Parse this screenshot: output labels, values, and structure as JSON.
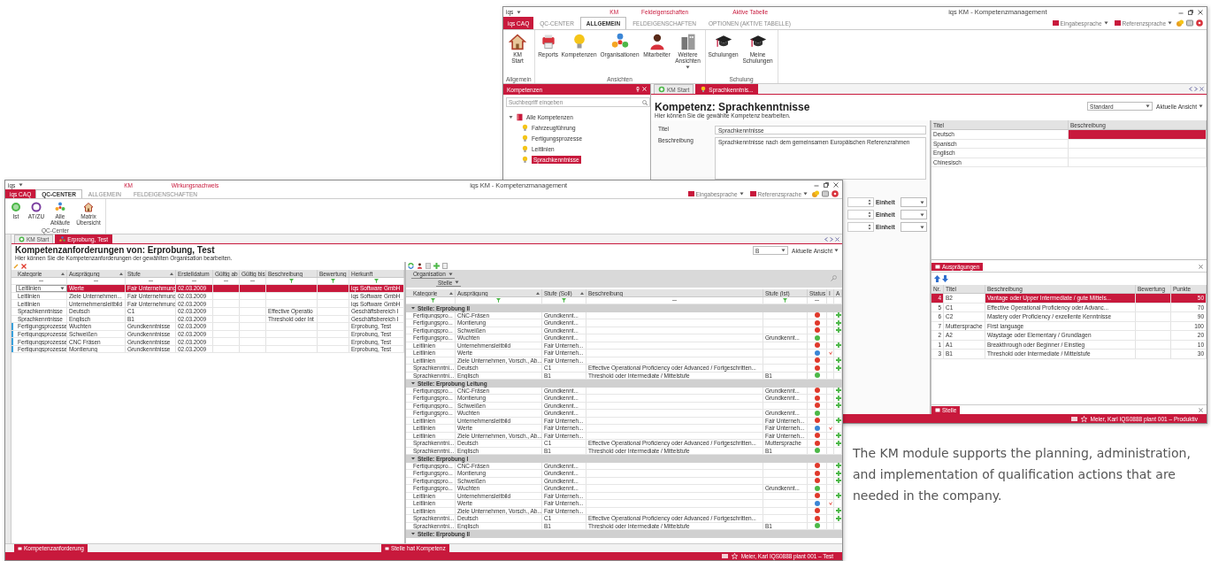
{
  "back_window": {
    "quick_access": "iqs",
    "context_labels": [
      "KM",
      "Feldeigenschaften",
      "Aktive Tabelle"
    ],
    "title": "iqs KM - Kompetenzmanagement",
    "app_menu": "iqs CAQ",
    "ribbon_tabs": [
      {
        "label": "QC-CENTER",
        "selected": false
      },
      {
        "label": "ALLGEMEIN",
        "selected": true
      },
      {
        "label": "FELDEIGENSCHAFTEN",
        "selected": false
      },
      {
        "label": "OPTIONEN (AKTIVE TABELLE)",
        "selected": false
      }
    ],
    "language_menus": [
      "Eingabesprache",
      "Referenzsprache"
    ],
    "ribbon_groups": [
      {
        "label": "Allgemein",
        "buttons": [
          {
            "label": "KM Start",
            "kind": "house"
          }
        ]
      },
      {
        "label": "Ansichten",
        "buttons": [
          {
            "label": "Reports",
            "kind": "report"
          },
          {
            "label": "Kompetenzen",
            "kind": "bulb"
          },
          {
            "label": "Organisationen",
            "kind": "org"
          },
          {
            "label": "Mitarbeiter",
            "kind": "person"
          },
          {
            "label": "Weitere Ansichten",
            "kind": "building",
            "dropdown": true
          }
        ]
      },
      {
        "label": "Schulung",
        "buttons": [
          {
            "label": "Schulungen",
            "kind": "cap"
          },
          {
            "label": "Meine Schulungen",
            "kind": "cap"
          }
        ]
      }
    ],
    "side_panel": {
      "title": "Kompetenzen",
      "search_placeholder": "Suchbegriff eingeben",
      "tree": [
        {
          "label": "Alle Kompetenzen",
          "kind": "book",
          "expanded": true,
          "selected": false,
          "children": [
            {
              "label": "Fahrzeugführung",
              "kind": "bulb",
              "selected": false
            },
            {
              "label": "Fertigungsprozesse",
              "kind": "bulb",
              "selected": false
            },
            {
              "label": "Leitlinien",
              "kind": "bulb",
              "selected": false
            },
            {
              "label": "Sprachkenntnisse",
              "kind": "bulb",
              "selected": true
            }
          ]
        }
      ]
    },
    "doc_tabs": [
      {
        "label": "KM Start",
        "kind": "start",
        "selected": false
      },
      {
        "label": "Sprachkenntnis...",
        "kind": "bulb",
        "selected": true
      }
    ],
    "heading": "Kompetenz: Sprachkenntnisse",
    "subheading": "Hier können Sie die gewählte Kompetenz bearbeiten.",
    "view_select": "Standard",
    "view_menu": "Aktuelle Ansicht",
    "fields": [
      {
        "label": "Titel",
        "value": "Sprachkenntnisse",
        "kind": "line"
      },
      {
        "label": "Beschreibung",
        "value": "Sprachkenntnisse nach dem gemeinsamen Europäischen Referenzrahmen",
        "kind": "area"
      }
    ],
    "unit_labels": [
      "Einheit",
      "Einheit",
      "Einheit"
    ],
    "translations": {
      "columns": [
        "Titel",
        "Beschreibung"
      ],
      "rows": [
        {
          "title": "Deutsch",
          "selected": true
        },
        {
          "title": "Spanisch",
          "selected": false
        },
        {
          "title": "Englisch",
          "selected": false
        },
        {
          "title": "Chinesisch",
          "selected": false
        }
      ]
    },
    "levels_panel": {
      "title": "Ausprägungen",
      "columns": [
        "Nr.",
        "Titel",
        "Beschreibung",
        "Bewertung",
        "Punkte"
      ],
      "rows": [
        {
          "nr": "4",
          "title": "B2",
          "description": "Vantage oder Upper Intermediate / gute Mittels...",
          "points": "50",
          "selected": true
        },
        {
          "nr": "5",
          "title": "C1",
          "description": "Effective Operational Proficiency oder Advanc...",
          "points": "70",
          "selected": false
        },
        {
          "nr": "6",
          "title": "C2",
          "description": "Mastery oder Proficiency / exzellente Kenntnisse",
          "points": "90",
          "selected": false
        },
        {
          "nr": "7",
          "title": "Muttersprache",
          "description": "First language",
          "points": "100",
          "selected": false
        },
        {
          "nr": "2",
          "title": "A2",
          "description": "Waystage oder Elementary / Grundlagen",
          "points": "20",
          "selected": false
        },
        {
          "nr": "1",
          "title": "A1",
          "description": "Breakthrough oder Beginner / Einstieg",
          "points": "10",
          "selected": false
        },
        {
          "nr": "3",
          "title": "B1",
          "description": "Threshold oder Intermediate / Mittelstufe",
          "points": "30",
          "selected": false
        }
      ]
    },
    "bottom_tab": "Stelle",
    "status": "Meier, Karl  IQS0888  plant 001  –  Produktiv"
  },
  "front_window": {
    "quick_access": "iqs",
    "context_labels": [
      "KM",
      "Wirkungsnachweis"
    ],
    "title": "iqs KM - Kompetenzmanagement",
    "app_menu": "iqs CAQ",
    "ribbon_tabs": [
      {
        "label": "QC-CENTER",
        "selected": true
      },
      {
        "label": "ALLGEMEIN",
        "selected": false
      },
      {
        "label": "FELDEIGENSCHAFTEN",
        "selected": false
      }
    ],
    "language_menus": [
      "Eingabesprache",
      "Referenzsprache"
    ],
    "ribbon_groups": [
      {
        "label": "QC-Center",
        "buttons": [
          {
            "label": "Ist",
            "kind": "green"
          },
          {
            "label": "AT/ZU",
            "kind": "ring"
          },
          {
            "label": "Alle Abläufe",
            "kind": "org"
          },
          {
            "label": "Matrix Übersicht",
            "kind": "house"
          }
        ]
      }
    ],
    "doc_tabs": [
      {
        "label": "KM Start",
        "kind": "start",
        "selected": false
      },
      {
        "label": "Erprobung, Test",
        "kind": "org",
        "selected": true
      }
    ],
    "heading": "Kompetenzanforderungen von: Erprobung, Test",
    "subheading": "Hier können Sie die Kompetenzanforderungen der gewählten Organisation bearbeiten.",
    "view_select": "B",
    "view_menu": "Aktuelle Ansicht",
    "requirements": {
      "columns": [
        {
          "label": "Kategorie",
          "sorted": true,
          "kind": "text"
        },
        {
          "label": "Ausprägung",
          "sorted": true,
          "kind": "text"
        },
        {
          "label": "Stufe",
          "sorted": true,
          "kind": "text"
        },
        {
          "label": "Erstelldatum",
          "sorted": false,
          "kind": "text"
        },
        {
          "label": "Gültig ab",
          "sorted": false,
          "kind": "text"
        },
        {
          "label": "Gültig bis",
          "sorted": false,
          "kind": "text"
        },
        {
          "label": "Beschreibung",
          "sorted": false,
          "kind": "filter"
        },
        {
          "label": "Bewertung",
          "sorted": false,
          "kind": "filter"
        },
        {
          "label": "Herkunft",
          "sorted": false,
          "kind": "filter"
        }
      ],
      "rows": [
        {
          "cells": [
            "Leitlinien",
            "Werte",
            "Fair Unternehmung",
            "02.03.2009",
            null,
            null,
            null,
            null,
            "iqs Software GmbH"
          ],
          "selected": true
        },
        {
          "cells": [
            "Leitlinien",
            "Ziele Unternehmen...",
            "Fair Unternehmung",
            "02.03.2009",
            null,
            null,
            null,
            null,
            "iqs Software GmbH"
          ],
          "selected": false
        },
        {
          "cells": [
            "Leitlinien",
            "Unternehmensleitbild",
            "Fair Unternehmung",
            "02.03.2009",
            null,
            null,
            null,
            null,
            "iqs Software GmbH"
          ],
          "selected": false
        },
        {
          "cells": [
            "Sprachkenntnisse",
            "Deutsch",
            "C1",
            "02.03.2009",
            null,
            null,
            "Effective Operatio",
            null,
            "Geschäftsbereich I"
          ],
          "selected": false
        },
        {
          "cells": [
            "Sprachkenntnisse",
            "Englisch",
            "B1",
            "02.03.2009",
            null,
            null,
            "Threshold oder Int",
            null,
            "Geschäftsbereich I"
          ],
          "selected": false
        },
        {
          "cells": [
            "Fertigungsprozesse",
            "Wuchten",
            "Grundkenntnisse",
            "02.03.2009",
            null,
            null,
            null,
            null,
            "Erprobung, Test"
          ],
          "selected": false,
          "color": "#3aa0dc"
        },
        {
          "cells": [
            "Fertigungsprozesse",
            "Schweißen",
            "Grundkenntnisse",
            "02.03.2009",
            null,
            null,
            null,
            null,
            "Erprobung, Test"
          ],
          "selected": false,
          "color": "#3aa0dc"
        },
        {
          "cells": [
            "Fertigungsprozesse",
            "CNC Fräsen",
            "Grundkenntnisse",
            "02.03.2009",
            null,
            null,
            null,
            null,
            "Erprobung, Test"
          ],
          "selected": false,
          "color": "#3aa0dc"
        },
        {
          "cells": [
            "Fertigungsprozesse",
            "Montierung",
            "Grundkenntnisse",
            "02.03.2009",
            null,
            null,
            null,
            null,
            "Erprobung, Test"
          ],
          "selected": false,
          "color": "#3aa0dc"
        }
      ]
    },
    "assignments": {
      "group_by": [
        "Organisation",
        "Stelle"
      ],
      "columns": [
        {
          "label": "Kategorie",
          "sorted": true,
          "kind": "filter"
        },
        {
          "label": "Ausprägung",
          "sorted": true,
          "kind": "filter"
        },
        {
          "label": "Stufe (Soll)",
          "sorted": true,
          "kind": "filter"
        },
        {
          "label": "Beschreibung",
          "sorted": false,
          "kind": "text"
        },
        {
          "label": "Stufe (Ist)",
          "sorted": false,
          "kind": "filter"
        },
        {
          "label": "Status",
          "sorted": false,
          "kind": "text"
        },
        {
          "label": "I",
          "sorted": false,
          "kind": "blank"
        },
        {
          "label": "A",
          "sorted": false,
          "kind": "blank"
        }
      ],
      "groups": [
        {
          "label": "Stelle: Erprobung II",
          "rows": [
            {
              "cells": [
                "Fertigungspro...",
                "CNC-Fräsen",
                "Grundkennt...",
                null,
                null
              ],
              "color": "#e0392b",
              "kind": "add"
            },
            {
              "cells": [
                "Fertigungspro...",
                "Montierung",
                "Grundkennt...",
                null,
                null
              ],
              "color": "#e0392b",
              "kind": "add"
            },
            {
              "cells": [
                "Fertigungspro...",
                "Schweißen",
                "Grundkennt...",
                null,
                null
              ],
              "color": "#e0392b",
              "kind": "add"
            },
            {
              "cells": [
                "Fertigungspro...",
                "Wuchten",
                "Grundkennt...",
                null,
                "Grundkennt..."
              ],
              "color": "#4cb848",
              "kind": "plain"
            },
            {
              "cells": [
                "Leitlinien",
                "Unternehmensleitbild",
                "Fair Unterneh...",
                null,
                null
              ],
              "color": "#e0392b",
              "kind": "add"
            },
            {
              "cells": [
                "Leitlinien",
                "Werte",
                "Fair Unterneh...",
                null,
                null
              ],
              "color": "#3b86d6",
              "kind": "mark"
            },
            {
              "cells": [
                "Leitlinien",
                "Ziele Unternehmen, Vorsch., Ab...",
                "Fair Unterneh...",
                null,
                null
              ],
              "color": "#e0392b",
              "kind": "add"
            },
            {
              "cells": [
                "Sprachkenntni...",
                "Deutsch",
                "C1",
                "Effective Operational Proficiency oder Advanced / Fortgeschritten...",
                null
              ],
              "color": "#e0392b",
              "kind": "add"
            },
            {
              "cells": [
                "Sprachkenntni...",
                "Englisch",
                "B1",
                "Threshold oder Intermediate / Mittelstufe",
                "B1"
              ],
              "color": "#4cb848",
              "kind": "plain"
            }
          ]
        },
        {
          "label": "Stelle: Erprobung Leitung",
          "rows": [
            {
              "cells": [
                "Fertigungspro...",
                "CNC-Fräsen",
                "Grundkennt...",
                null,
                "Grundkennt..."
              ],
              "color": "#e0392b",
              "kind": "add"
            },
            {
              "cells": [
                "Fertigungspro...",
                "Montierung",
                "Grundkennt...",
                null,
                "Grundkennt..."
              ],
              "color": "#e0392b",
              "kind": "add"
            },
            {
              "cells": [
                "Fertigungspro...",
                "Schweißen",
                "Grundkennt...",
                null,
                null
              ],
              "color": "#e0392b",
              "kind": "add"
            },
            {
              "cells": [
                "Fertigungspro...",
                "Wuchten",
                "Grundkennt...",
                null,
                "Grundkennt..."
              ],
              "color": "#4cb848",
              "kind": "plain"
            },
            {
              "cells": [
                "Leitlinien",
                "Unternehmensleitbild",
                "Fair Unterneh...",
                null,
                "Fair Unterneh..."
              ],
              "color": "#e0392b",
              "kind": "add"
            },
            {
              "cells": [
                "Leitlinien",
                "Werte",
                "Fair Unterneh...",
                null,
                "Fair Unterneh..."
              ],
              "color": "#3b86d6",
              "kind": "mark"
            },
            {
              "cells": [
                "Leitlinien",
                "Ziele Unternehmen, Vorsch., Ab...",
                "Fair Unterneh...",
                null,
                "Fair Unterneh..."
              ],
              "color": "#e0392b",
              "kind": "add"
            },
            {
              "cells": [
                "Sprachkenntni...",
                "Deutsch",
                "C1",
                "Effective Operational Proficiency oder Advanced / Fortgeschritten...",
                "Muttersprache"
              ],
              "color": "#e0392b",
              "kind": "add"
            },
            {
              "cells": [
                "Sprachkenntni...",
                "Englisch",
                "B1",
                "Threshold oder Intermediate / Mittelstufe",
                "B1"
              ],
              "color": "#4cb848",
              "kind": "plain"
            }
          ]
        },
        {
          "label": "Stelle: Erprobung I",
          "rows": [
            {
              "cells": [
                "Fertigungspro...",
                "CNC-Fräsen",
                "Grundkennt...",
                null,
                null
              ],
              "color": "#e0392b",
              "kind": "add"
            },
            {
              "cells": [
                "Fertigungspro...",
                "Montierung",
                "Grundkennt...",
                null,
                null
              ],
              "color": "#e0392b",
              "kind": "add"
            },
            {
              "cells": [
                "Fertigungspro...",
                "Schweißen",
                "Grundkennt...",
                null,
                null
              ],
              "color": "#e0392b",
              "kind": "add"
            },
            {
              "cells": [
                "Fertigungspro...",
                "Wuchten",
                "Grundkennt...",
                null,
                "Grundkennt..."
              ],
              "color": "#4cb848",
              "kind": "plain"
            },
            {
              "cells": [
                "Leitlinien",
                "Unternehmensleitbild",
                "Fair Unterneh...",
                null,
                null
              ],
              "color": "#e0392b",
              "kind": "add"
            },
            {
              "cells": [
                "Leitlinien",
                "Werte",
                "Fair Unterneh...",
                null,
                null
              ],
              "color": "#3b86d6",
              "kind": "mark"
            },
            {
              "cells": [
                "Leitlinien",
                "Ziele Unternehmen, Vorsch., Ab...",
                "Fair Unterneh...",
                null,
                null
              ],
              "color": "#e0392b",
              "kind": "add"
            },
            {
              "cells": [
                "Sprachkenntni...",
                "Deutsch",
                "C1",
                "Effective Operational Proficiency oder Advanced / Fortgeschritten...",
                null
              ],
              "color": "#e0392b",
              "kind": "add"
            },
            {
              "cells": [
                "Sprachkenntni...",
                "Englisch",
                "B1",
                "Threshold oder Intermediate / Mittelstufe",
                "B1"
              ],
              "color": "#4cb848",
              "kind": "plain"
            }
          ]
        },
        {
          "label": "Stelle: Erprobung II"
        }
      ]
    },
    "bottom_tabs": [
      "Kompetenzanforderung",
      "Stelle hat Kompetenz"
    ],
    "status": "Meier, Karl  IQS0888  plant 001  –  Test"
  },
  "caption": "The KM module supports the planning, administration, and implementation of qualification actions that are needed in the company."
}
